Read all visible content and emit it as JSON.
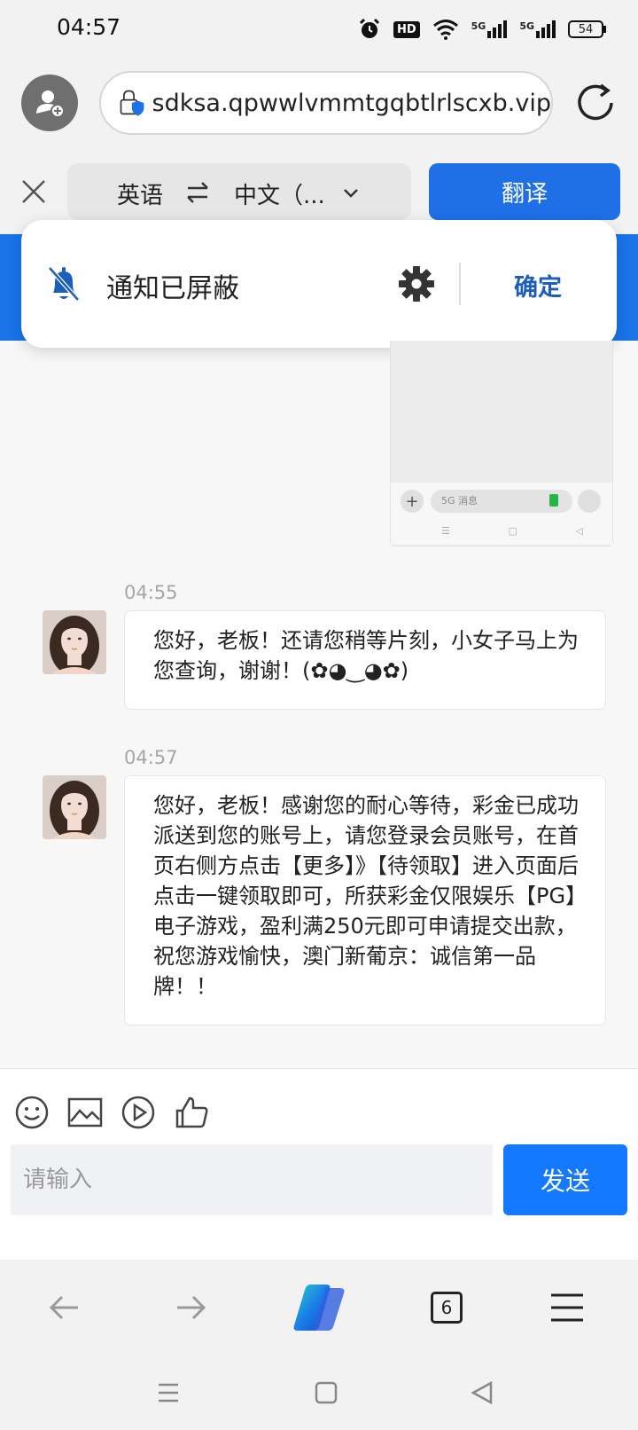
{
  "status": {
    "time": "04:57",
    "hd": "HD",
    "network1": "5G",
    "network2": "5G",
    "battery": "54"
  },
  "browser": {
    "url": "sdksa.qpwwlvmmtgqbtlrlscxb.vip",
    "tab_count": "6"
  },
  "translate": {
    "source_lang": "英语",
    "target_lang": "中文（...",
    "button": "翻译"
  },
  "notification": {
    "text": "通知已屏蔽",
    "confirm": "确定"
  },
  "thumbnail": {
    "input_placeholder": "5G 消息",
    "sim": "1"
  },
  "chat": {
    "messages": [
      {
        "time": "04:55",
        "text": "您好，老板！还请您稍等片刻，小女子马上为您查询，谢谢！(✿◕‿◕✿)"
      },
      {
        "time": "04:57",
        "text": "您好，老板！感谢您的耐心等待，彩金已成功派送到您的账号上，请您登录会员账号，在首页右侧方点击【更多】》【待领取】进入页面后点击一键领取即可，所获彩金仅限娱乐【PG】电子游戏，盈利满250元即可申请提交出款，祝您游戏愉快，澳门新葡京：诚信第一品牌！！"
      }
    ]
  },
  "composer": {
    "placeholder": "请输入",
    "send": "发送"
  },
  "colors": {
    "accent": "#1479ff",
    "translate_button": "#1f6fe6",
    "link": "#1d5fb8"
  }
}
